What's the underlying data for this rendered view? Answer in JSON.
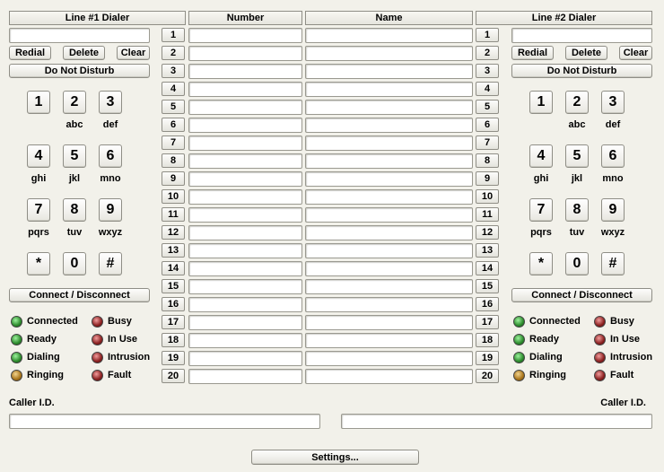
{
  "headers": {
    "line1": "Line #1 Dialer",
    "number": "Number",
    "name": "Name",
    "line2": "Line #2 Dialer"
  },
  "dialer": {
    "redial": "Redial",
    "delete": "Delete",
    "clear": "Clear",
    "dnd": "Do Not Disturb",
    "connect": "Connect / Disconnect",
    "keys": [
      {
        "digit": "1",
        "letters": ""
      },
      {
        "digit": "2",
        "letters": "abc"
      },
      {
        "digit": "3",
        "letters": "def"
      },
      {
        "digit": "4",
        "letters": "ghi"
      },
      {
        "digit": "5",
        "letters": "jkl"
      },
      {
        "digit": "6",
        "letters": "mno"
      },
      {
        "digit": "7",
        "letters": "pqrs"
      },
      {
        "digit": "8",
        "letters": "tuv"
      },
      {
        "digit": "9",
        "letters": "wxyz"
      },
      {
        "digit": "*",
        "letters": ""
      },
      {
        "digit": "0",
        "letters": ""
      },
      {
        "digit": "#",
        "letters": ""
      }
    ],
    "status": [
      {
        "label": "Connected",
        "color": "green"
      },
      {
        "label": "Busy",
        "color": "red"
      },
      {
        "label": "Ready",
        "color": "green"
      },
      {
        "label": "In Use",
        "color": "red"
      },
      {
        "label": "Dialing",
        "color": "green"
      },
      {
        "label": "Intrusion",
        "color": "red"
      },
      {
        "label": "Ringing",
        "color": "amber"
      },
      {
        "label": "Fault",
        "color": "red"
      }
    ]
  },
  "directory": {
    "rows": [
      "1",
      "2",
      "3",
      "4",
      "5",
      "6",
      "7",
      "8",
      "9",
      "10",
      "11",
      "12",
      "13",
      "14",
      "15",
      "16",
      "17",
      "18",
      "19",
      "20"
    ]
  },
  "caller_id": {
    "label": "Caller I.D."
  },
  "settings": "Settings..."
}
